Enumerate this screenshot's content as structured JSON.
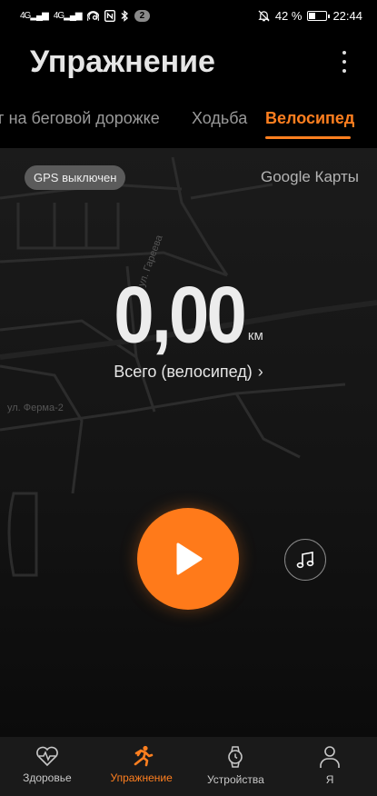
{
  "status_bar": {
    "signal_1": "4G",
    "signal_2": "4G",
    "notification_count": "2",
    "battery_percent": "42 %",
    "battery_level": 0.42,
    "time": "22:44"
  },
  "header": {
    "title": "Упражнение"
  },
  "tabs": [
    {
      "label": "г на беговой дорожке",
      "active": false
    },
    {
      "label": "Ходьба",
      "active": false
    },
    {
      "label": "Велосипед",
      "active": true
    }
  ],
  "map": {
    "gps_status": "GPS выключен",
    "source": "Google Карты",
    "street_1": "ул. Гареева",
    "street_2": "ул. Ферма-2"
  },
  "workout": {
    "distance_value": "0,00",
    "distance_unit": "км",
    "total_label": "Всего (велосипед)"
  },
  "colors": {
    "accent": "#ff7f1f",
    "background": "#000000",
    "nav_background": "#1a1a1a"
  },
  "bottom_nav": [
    {
      "label": "Здоровье",
      "icon": "heart-pulse-icon",
      "active": false
    },
    {
      "label": "Упражнение",
      "icon": "runner-icon",
      "active": true
    },
    {
      "label": "Устройства",
      "icon": "watch-icon",
      "active": false
    },
    {
      "label": "Я",
      "icon": "person-icon",
      "active": false
    }
  ]
}
